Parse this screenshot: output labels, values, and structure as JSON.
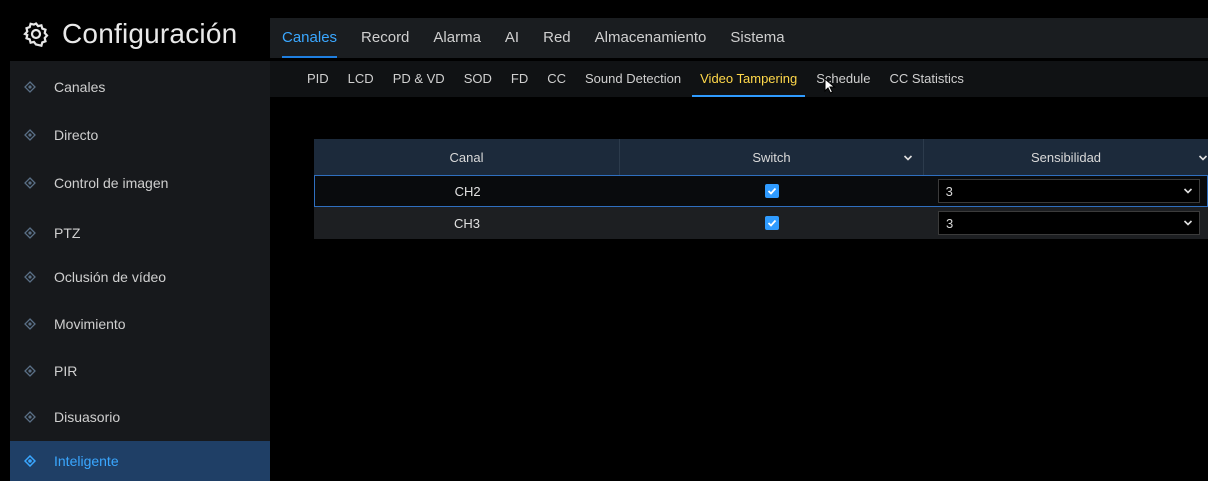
{
  "app": {
    "title": "Configuración",
    "icon": "gear-icon"
  },
  "main_tabs": [
    {
      "label": "Canales",
      "active": true
    },
    {
      "label": "Record"
    },
    {
      "label": "Alarma"
    },
    {
      "label": "AI"
    },
    {
      "label": "Red"
    },
    {
      "label": "Almacenamiento"
    },
    {
      "label": "Sistema"
    }
  ],
  "sidebar": {
    "items": [
      {
        "label": "Canales"
      },
      {
        "label": "Directo"
      },
      {
        "label": "Control de imagen"
      },
      {
        "label": "PTZ"
      },
      {
        "label": "Oclusión de vídeo"
      },
      {
        "label": "Movimiento"
      },
      {
        "label": "PIR"
      },
      {
        "label": "Disuasorio"
      },
      {
        "label": "Inteligente",
        "active": true
      }
    ]
  },
  "sub_tabs": [
    {
      "label": "PID"
    },
    {
      "label": "LCD"
    },
    {
      "label": "PD & VD"
    },
    {
      "label": "SOD"
    },
    {
      "label": "FD"
    },
    {
      "label": "CC"
    },
    {
      "label": "Sound Detection"
    },
    {
      "label": "Video Tampering",
      "active": true
    },
    {
      "label": "Schedule"
    },
    {
      "label": "CC Statistics"
    }
  ],
  "table": {
    "headers": {
      "canal": "Canal",
      "switch": "Switch",
      "sensibilidad": "Sensibilidad"
    },
    "rows": [
      {
        "canal": "CH2",
        "switch": true,
        "sensibilidad": "3"
      },
      {
        "canal": "CH3",
        "switch": true,
        "sensibilidad": "3"
      }
    ]
  },
  "colors": {
    "accent": "#3aa7ff",
    "active_subtab": "#ffd84a",
    "sidebar_bg": "#17191c",
    "sidebar_active_bg": "#1f3f66",
    "table_header_bg": "#1c2a3b"
  }
}
